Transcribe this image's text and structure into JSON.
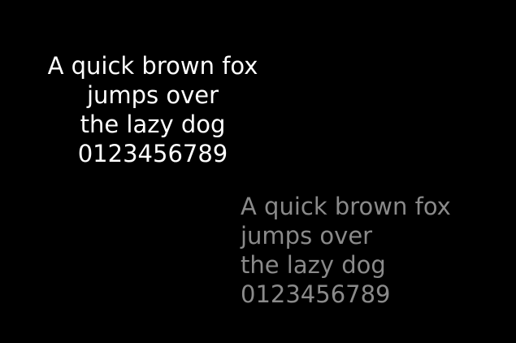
{
  "blocks": [
    {
      "color": "#ffffff",
      "lines": [
        "A quick brown fox",
        "jumps over",
        "the lazy dog",
        "0123456789"
      ]
    },
    {
      "color": "#8a8a8a",
      "lines": [
        "A quick brown fox",
        "jumps over",
        "the lazy dog",
        "0123456789"
      ]
    }
  ]
}
